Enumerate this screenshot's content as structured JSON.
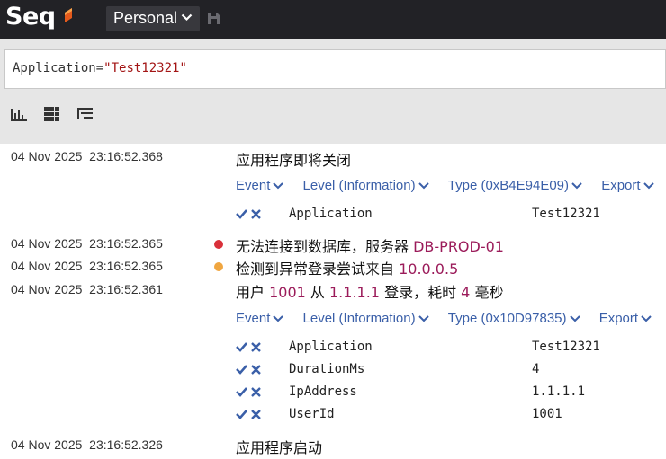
{
  "app": {
    "logo": "Seq",
    "workspace": "Personal"
  },
  "icons": {
    "workspace_chevron": "chevron-down-icon",
    "save": "save-icon",
    "tools": [
      "histogram-icon",
      "grid-icon",
      "tree-list-icon"
    ]
  },
  "colors": {
    "topbar": "#222226",
    "accent": "#e55a1c",
    "link": "#3a5fa8",
    "highlight": "#9b1b5a",
    "error": "#d9303a",
    "warning": "#f0a640"
  },
  "search": {
    "prefix": "Application=",
    "value": "\"Test12321\""
  },
  "actions_labels": {
    "event": "Event",
    "level": "Level (Information)",
    "export": "Export"
  },
  "events": [
    {
      "timestamp": "04 Nov 2025  23:16:52.368",
      "message": "应用程序即将关闭",
      "type_label": "Type (0xB4E94E09)",
      "properties": [
        {
          "name": "Application",
          "value": "Test12321"
        }
      ]
    },
    {
      "timestamp": "04 Nov 2025  23:16:52.365",
      "level": "error",
      "message_prefix": "无法连接到数据库，服务器 ",
      "message_server": "DB-PROD-01"
    },
    {
      "timestamp": "04 Nov 2025  23:16:52.365",
      "level": "warning",
      "message_prefix": "检测到异常登录尝试来自 ",
      "message_ip": "10.0.0.5"
    },
    {
      "timestamp": "04 Nov 2025  23:16:52.361",
      "message_parts": [
        "用户 ",
        "1001",
        " 从 ",
        "1.1.1.1",
        " 登录，耗时 ",
        "4",
        " 毫秒"
      ],
      "type_label": "Type (0x10D97835)",
      "properties": [
        {
          "name": "Application",
          "value": "Test12321"
        },
        {
          "name": "DurationMs",
          "value": "4"
        },
        {
          "name": "IpAddress",
          "value": "1.1.1.1"
        },
        {
          "name": "UserId",
          "value": "1001"
        }
      ]
    },
    {
      "timestamp": "04 Nov 2025  23:16:52.326",
      "message": "应用程序启动"
    }
  ]
}
